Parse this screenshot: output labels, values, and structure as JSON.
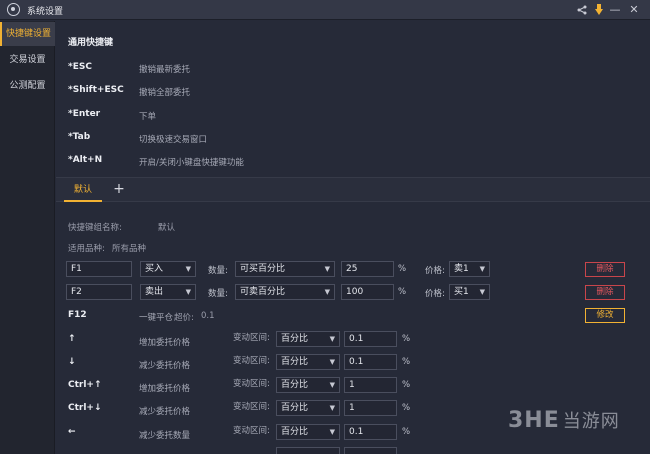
{
  "window": {
    "title": "系统设置"
  },
  "window_controls": {
    "share": "share-icon",
    "pin": "pin-icon",
    "minimize": "—",
    "close": "✕"
  },
  "sidebar": {
    "items": [
      {
        "label": "快捷键设置",
        "active": true
      },
      {
        "label": "交易设置"
      },
      {
        "label": "公测配置"
      }
    ]
  },
  "general": {
    "title": "通用快捷键",
    "hotkeys": [
      {
        "key": "*ESC",
        "desc": "撤销最新委托"
      },
      {
        "key": "*Shift+ESC",
        "desc": "撤销全部委托"
      },
      {
        "key": "*Enter",
        "desc": "下单"
      },
      {
        "key": "*Tab",
        "desc": "切换极速交易窗口"
      },
      {
        "key": "*Alt+N",
        "desc": "开启/关闭小键盘快捷键功能"
      }
    ]
  },
  "tabs": {
    "default_label": "默认",
    "add_label": "+"
  },
  "group": {
    "name_label": "快捷键组名称:",
    "name_value": "默认",
    "varieties_label": "适用品种:",
    "varieties_value": "所有品种"
  },
  "order_rows": [
    {
      "key": "F1",
      "side": "买入",
      "qty_label": "数量:",
      "qty_mode": "可买百分比",
      "qty_value": "25",
      "pct": "%",
      "price_label": "价格:",
      "price": "卖1",
      "delete": "删除"
    },
    {
      "key": "F2",
      "side": "卖出",
      "qty_label": "数量:",
      "qty_mode": "可卖百分比",
      "qty_value": "100",
      "pct": "%",
      "price_label": "价格:",
      "price": "买1",
      "delete": "删除"
    }
  ],
  "f12_row": {
    "key": "F12",
    "action": "一键平仓",
    "extra_label": "超价:",
    "extra_value": "0.1",
    "edit": "修改"
  },
  "adjust_rows": [
    {
      "key": "↑",
      "action": "增加委托价格",
      "zone_label": "变动区间:",
      "mode": "百分比",
      "value": "0.1",
      "pct": "%"
    },
    {
      "key": "↓",
      "action": "减少委托价格",
      "zone_label": "变动区间:",
      "mode": "百分比",
      "value": "0.1",
      "pct": "%"
    },
    {
      "key": "Ctrl+↑",
      "action": "增加委托价格",
      "zone_label": "变动区间:",
      "mode": "百分比",
      "value": "1",
      "pct": "%"
    },
    {
      "key": "Ctrl+↓",
      "action": "减少委托价格",
      "zone_label": "变动区间:",
      "mode": "百分比",
      "value": "1",
      "pct": "%"
    },
    {
      "key": "←",
      "action": "减少委托数量",
      "zone_label": "变动区间:",
      "mode": "百分比",
      "value": "0.1",
      "pct": "%"
    }
  ],
  "watermark": {
    "logo": "3HE",
    "text": "当游网"
  },
  "colors": {
    "accent": "#f2b233",
    "danger": "#e0575d",
    "bg": "#262a38",
    "sidebar": "#22252f"
  }
}
